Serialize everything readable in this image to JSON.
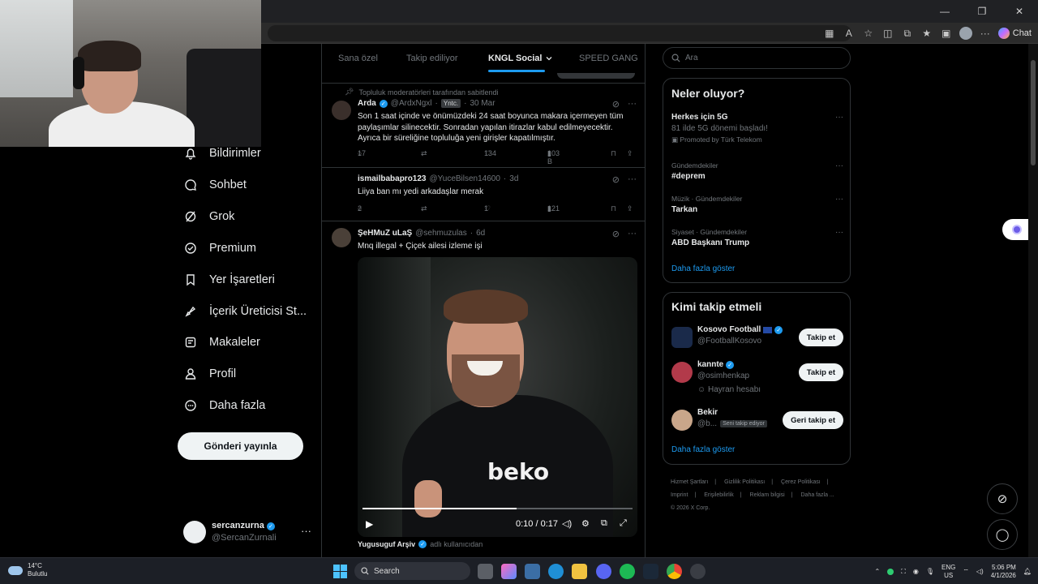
{
  "browser": {
    "window_controls": {
      "minimize": "—",
      "restore": "❐",
      "close": "✕"
    },
    "chat_label": "Chat"
  },
  "nav": {
    "items": [
      {
        "label": "Bildirimler",
        "icon": "bell-icon"
      },
      {
        "label": "Sohbet",
        "icon": "chat-bubble-icon"
      },
      {
        "label": "Grok",
        "icon": "grok-icon"
      },
      {
        "label": "Premium",
        "icon": "premium-icon"
      },
      {
        "label": "Yer İşaretleri",
        "icon": "bookmark-icon"
      },
      {
        "label": "İçerik Üreticisi St...",
        "icon": "rocket-icon"
      },
      {
        "label": "Makaleler",
        "icon": "articles-icon"
      },
      {
        "label": "Profil",
        "icon": "person-icon"
      },
      {
        "label": "Daha fazla",
        "icon": "more-circle-icon"
      }
    ],
    "post_button": "Gönderi yayınla",
    "account": {
      "name": "sercanzurna",
      "handle": "@SercanZurnali",
      "more": "···"
    }
  },
  "feed": {
    "tabs": [
      "Sana özel",
      "Takip ediliyor",
      "KNGL Social",
      "SPEED GANG"
    ],
    "active_tab": "KNGL Social",
    "tweets": [
      {
        "pinned_note": "Topluluk moderatörleri tarafından sabitlendi",
        "name": "Arda",
        "badge": "Yntc.",
        "handle": "@ArdxNgxl",
        "sep": "·",
        "date": "30 Mar",
        "text": "Son 1 saat içinde ve önümüzdeki 24 saat boyunca makara içermeyen tüm paylaşımlar silinecektir. Sonradan yapılan itirazlar kabul edilmeyecektir. Ayrıca bir süreliğine topluluğa yeni girişler kapatılmıştır.",
        "replies": "17",
        "reposts": "",
        "likes": "134",
        "views": "103 B"
      },
      {
        "name": "ismailbabapro123",
        "handle": "@YuceBilsen14600",
        "sep": "·",
        "date": "3d",
        "text": "Liiya ban mı yedi arkadaşlar merak",
        "replies": "2",
        "reposts": "",
        "likes": "1",
        "views": "121"
      },
      {
        "name": "ŞeHMuZ uLaŞ",
        "handle": "@sehmuzulas",
        "sep": "·",
        "date": "6d",
        "text": "Mnq illegal + Çiçek ailesi izleme işi",
        "video": {
          "sponsor_text": "beko",
          "time": "0:10 / 0:17",
          "progress": 0.57
        }
      }
    ],
    "next_preview": {
      "name": "Yugusuguf Arşiv",
      "note": "adlı kullanıcıdan"
    }
  },
  "right": {
    "search_placeholder": "Ara",
    "trends_title": "Neler oluyor?",
    "trends": [
      {
        "context": "",
        "title": "Herkes için 5G",
        "sub": "81 ilde 5G dönemi başladı!",
        "promo": "Promoted by Türk Telekom"
      },
      {
        "context": "Gündemdekiler",
        "title": "#deprem"
      },
      {
        "context": "Müzik · Gündemdekiler",
        "title": "Tarkan"
      },
      {
        "context": "Siyaset · Gündemdekiler",
        "title": "ABD Başkanı Trump"
      }
    ],
    "show_more": "Daha fazla göster",
    "who_to_follow_title": "Kimi takip etmeli",
    "follows": [
      {
        "name": "Kosovo Football",
        "handle": "@FootballKosovo",
        "button": "Takip et",
        "extra": ""
      },
      {
        "name": "kannte",
        "handle": "@osimhenkap",
        "button": "Takip et",
        "extra": "Hayran hesabı"
      },
      {
        "name": "Bekir",
        "handle": "@b...",
        "button": "Geri takip et",
        "extra": "",
        "follows_you": "Seni takip ediyor"
      }
    ],
    "footer": [
      "Hizmet Şartları",
      "|",
      "Gizlilik Politikası",
      "|",
      "Çerez Politikası",
      "|",
      "Imprint",
      "|",
      "Erişilebilirlik",
      "|",
      "Reklam bilgisi",
      "|",
      "Daha fazla ...",
      "© 2026 X Corp."
    ]
  },
  "taskbar": {
    "weather_temp": "14°C",
    "weather_desc": "Bulutlu",
    "search": "Search",
    "lang_top": "ENG",
    "lang_bottom": "US",
    "time": "5:06 PM",
    "date": "4/1/2026"
  },
  "colors": {
    "accent": "#1d9bf0",
    "bg": "#000000",
    "border": "#2f3336",
    "muted": "#71767b"
  }
}
